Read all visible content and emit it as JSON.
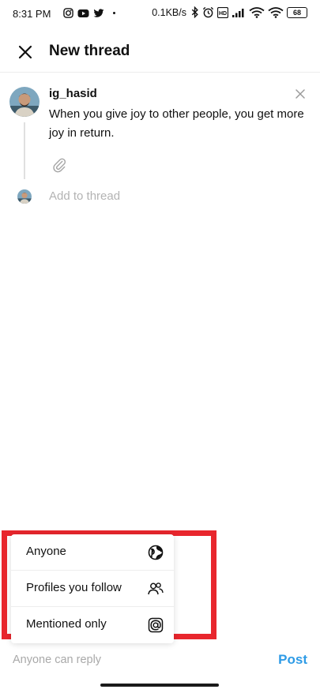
{
  "status_bar": {
    "time": "8:31 PM",
    "net_speed": "0.1KB/s",
    "battery": "68",
    "left_icons": [
      "instagram-icon",
      "youtube-icon",
      "twitter-icon",
      "dot-icon"
    ],
    "right_icons": [
      "bluetooth-icon",
      "alarm-icon",
      "volte-icon",
      "signal-icon",
      "wifi-icon",
      "wifi-icon",
      "battery-icon"
    ]
  },
  "header": {
    "title": "New thread",
    "close_icon": "close-icon"
  },
  "compose": {
    "username": "ig_hasid",
    "text": "When you give joy to other people, you get more joy in return.",
    "attach_icon": "paperclip-icon",
    "add_to_thread": "Add to thread"
  },
  "reply_menu": {
    "items": [
      {
        "label": "Anyone",
        "icon": "globe-icon"
      },
      {
        "label": "Profiles you follow",
        "icon": "people-icon"
      },
      {
        "label": "Mentioned only",
        "icon": "at-icon"
      }
    ]
  },
  "footer": {
    "reply_setting": "Anyone can reply",
    "post_label": "Post"
  },
  "colors": {
    "accent": "#2e9be6",
    "highlight": "#e8262d",
    "muted": "#a9a9a9"
  }
}
